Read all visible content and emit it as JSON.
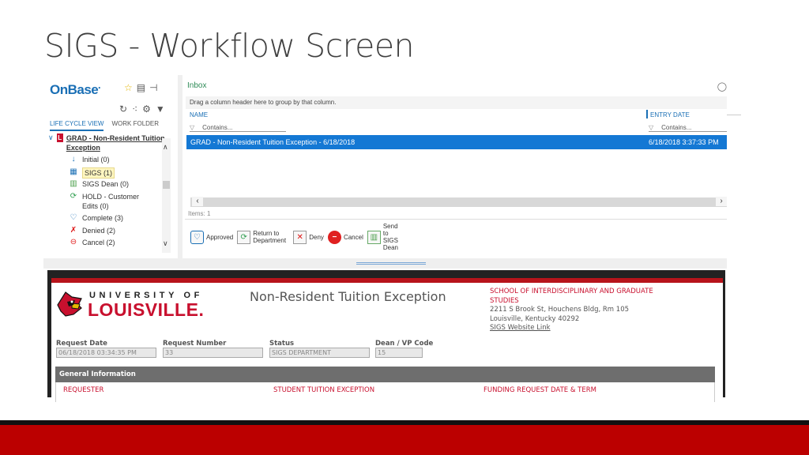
{
  "slide": {
    "title": "SIGS - Workflow Screen",
    "colors": {
      "accent_red": "#bb0000",
      "onbase_blue": "#1478d4",
      "uofl_red": "#c8102e"
    }
  },
  "onbase": {
    "logo": "OnBase",
    "top_icons": [
      "star-add-icon",
      "layout-icon",
      "pin-icon"
    ],
    "tool_icons": [
      "refresh-icon",
      "share-icon",
      "gear-icon",
      "filter-icon"
    ],
    "tabs": [
      {
        "label": "LIFE CYCLE VIEW",
        "active": true
      },
      {
        "label": "WORK FOLDER",
        "active": false
      }
    ],
    "tree": {
      "root_label": "GRAD - Non-Resident Tuition Exception",
      "items": [
        {
          "label": "Initial (0)",
          "icon": "arrow-down-icon",
          "selected": false
        },
        {
          "label": "SIGS (1)",
          "icon": "calculator-icon",
          "selected": true
        },
        {
          "label": "SIGS Dean (0)",
          "icon": "folder-icon",
          "selected": false
        },
        {
          "label": "HOLD - Customer Edits (0)",
          "icon": "cycle-icon",
          "selected": false
        },
        {
          "label": "Complete (3)",
          "icon": "balloon-icon",
          "selected": false
        },
        {
          "label": "Denied (2)",
          "icon": "denied-doc-icon",
          "selected": false
        },
        {
          "label": "Cancel (2)",
          "icon": "cancel-icon",
          "selected": false
        }
      ]
    },
    "inbox": {
      "title": "Inbox",
      "group_hint": "Drag a column header here to group by that column.",
      "columns": [
        {
          "label": "NAME",
          "filter_placeholder": "Contains..."
        },
        {
          "label": "ENTRY DATE",
          "filter_placeholder": "Contains..."
        }
      ],
      "rows": [
        {
          "name": "GRAD - Non-Resident Tuition Exception - 6/18/2018",
          "entry_date": "6/18/2018 3:37:33 PM",
          "selected": true
        }
      ],
      "items_count": "Items: 1"
    },
    "actions": [
      {
        "label": "Approved",
        "icon": "approved-icon"
      },
      {
        "label": "Return to Department",
        "icon": "return-icon"
      },
      {
        "label": "Deny",
        "icon": "deny-icon"
      },
      {
        "label": "Cancel",
        "icon": "cancel-icon"
      },
      {
        "label": "Send to SIGS Dean",
        "icon": "send-icon"
      }
    ]
  },
  "form": {
    "university_line1": "UNIVERSITY OF",
    "university_line2": "LOUISVILLE.",
    "title": "Non-Resident Tuition Exception",
    "school": {
      "name": "SCHOOL OF INTERDISCIPLINARY AND GRADUATE STUDIES",
      "address1": "2211 S Brook St, Houchens Bldg, Rm 105",
      "address2": "Louisville, Kentucky 40292",
      "link": "SIGS Website Link"
    },
    "fields": [
      {
        "label": "Request Date",
        "value": "06/18/2018 03:34:35 PM"
      },
      {
        "label": "Request Number",
        "value": "33"
      },
      {
        "label": "Status",
        "value": "SIGS DEPARTMENT"
      },
      {
        "label": "Dean / VP Code",
        "value": "15"
      }
    ],
    "section_header": "General Information",
    "section_labels": [
      "REQUESTER",
      "STUDENT TUITION EXCEPTION",
      "FUNDING REQUEST DATE & TERM"
    ]
  }
}
